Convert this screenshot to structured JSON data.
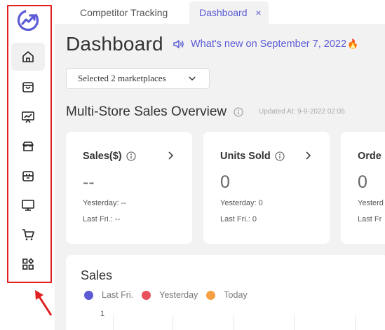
{
  "tabs": [
    {
      "label": "Competitor Tracking"
    },
    {
      "label": "Dashboard",
      "close": "×"
    }
  ],
  "header": {
    "title": "Dashboard",
    "whats_new": "What's new on September 7, 2022",
    "fire_icon": "🔥"
  },
  "marketplace_select": {
    "value": "Selected 2 marketplaces"
  },
  "overview": {
    "title": "Multi-Store Sales Overview",
    "updated": "Updated At: 9-9-2022 02:05"
  },
  "cards": [
    {
      "title": "Sales($)",
      "value": "--",
      "yesterday": "Yesterday: --",
      "last_fri": "Last Fri.: --"
    },
    {
      "title": "Units Sold",
      "value": "0",
      "yesterday": "Yesterday: 0",
      "last_fri": "Last Fri.: 0"
    },
    {
      "title": "Orde",
      "value": "0",
      "yesterday": "Yesterd",
      "last_fri": "Last Fr"
    }
  ],
  "sales_chart": {
    "title": "Sales",
    "legend": [
      {
        "label": "Last Fri.",
        "color": "#5b5bd6"
      },
      {
        "label": "Yesterday",
        "color": "#e8505b"
      },
      {
        "label": "Today",
        "color": "#f5a043"
      }
    ],
    "y_tick": "1"
  },
  "sidebar": {
    "items": [
      {
        "icon": "home-icon"
      },
      {
        "icon": "shopping-bag-icon"
      },
      {
        "icon": "chart-screen-icon"
      },
      {
        "icon": "store-icon"
      },
      {
        "icon": "package-icon"
      },
      {
        "icon": "monitor-icon"
      },
      {
        "icon": "cart-icon"
      },
      {
        "icon": "apps-icon"
      }
    ]
  },
  "colors": {
    "accent": "#5b5bd6",
    "highlight": "#e02020"
  }
}
